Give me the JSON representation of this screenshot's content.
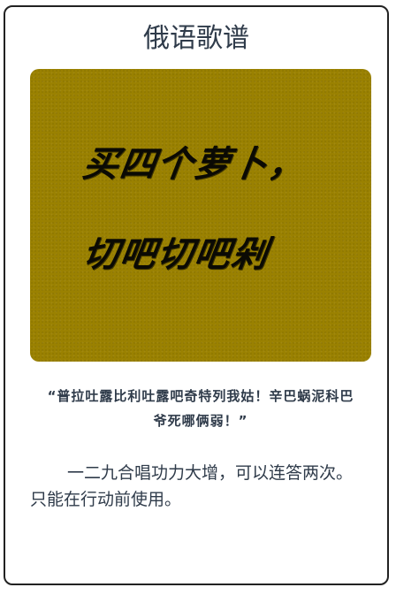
{
  "card": {
    "title": "俄语歌谱",
    "art_lines": [
      "买四个萝卜，",
      "切吧切吧剁"
    ],
    "quote": "“普拉吐露比利吐露吧奇特列我姑！辛巴蜗泥科巴爷死哪俩弱！”",
    "description": "一二九合唱功力大增，可以连答两次。只能在行动前使用。"
  },
  "colors": {
    "border": "#222222",
    "art_background": "#9a8101",
    "text": "#2f3b4a",
    "art_text": "#0b0a04"
  }
}
